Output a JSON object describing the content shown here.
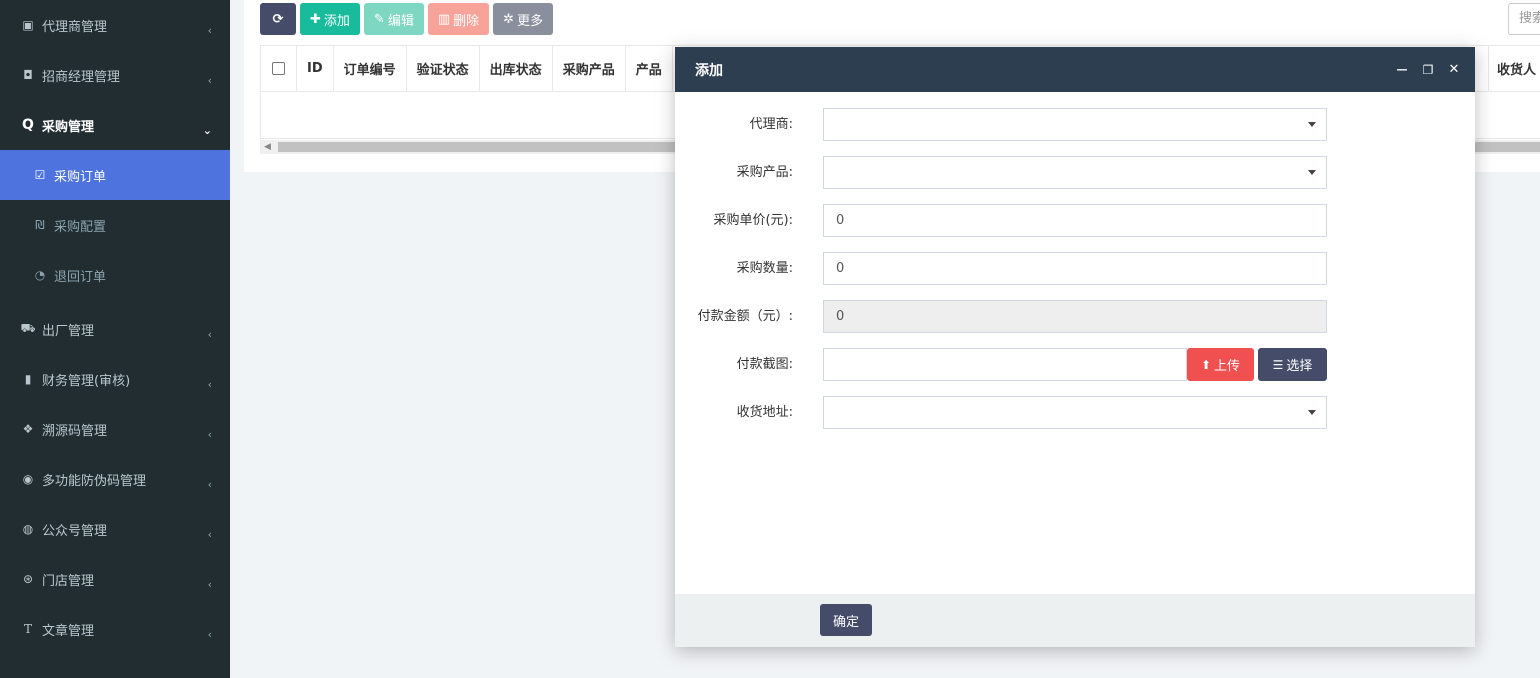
{
  "sidebar": {
    "items": [
      {
        "icon": "id-card-icon",
        "glyph": "▣",
        "label": "代理商管理"
      },
      {
        "icon": "user-badge-icon",
        "glyph": "◘",
        "label": "招商经理管理"
      },
      {
        "icon": "search-icon",
        "glyph": "Q",
        "label": "采购管理"
      },
      {
        "icon": "truck-icon",
        "glyph": "⛟",
        "label": "出厂管理"
      },
      {
        "icon": "book-icon",
        "glyph": "▮",
        "label": "财务管理(审核)"
      },
      {
        "icon": "cubes-icon",
        "glyph": "❖",
        "label": "溯源码管理"
      },
      {
        "icon": "info-circle-icon",
        "glyph": "◉",
        "label": "多功能防伪码管理"
      },
      {
        "icon": "wechat-icon",
        "glyph": "◍",
        "label": "公众号管理"
      },
      {
        "icon": "cog-circle-icon",
        "glyph": "⊛",
        "label": "门店管理"
      },
      {
        "icon": "text-icon",
        "glyph": "T",
        "label": "文章管理"
      }
    ],
    "subitems": [
      {
        "icon": "calendar-check-icon",
        "glyph": "☑",
        "label": "采购订单"
      },
      {
        "icon": "sliders-icon",
        "glyph": "₪",
        "label": "采购配置"
      },
      {
        "icon": "undo-icon",
        "glyph": "◔",
        "label": "退回订单"
      }
    ]
  },
  "toolbar": {
    "refresh_glyph": "⟳",
    "add_label": "添加",
    "add_glyph": "✚",
    "edit_label": "编辑",
    "edit_glyph": "✎",
    "delete_label": "删除",
    "delete_glyph": "▥",
    "more_label": "更多",
    "more_glyph": "✲"
  },
  "search": {
    "placeholder": "搜索"
  },
  "table": {
    "columns": [
      "ID",
      "订单编号",
      "验证状态",
      "出库状态",
      "采购产品",
      "产品",
      "收货人"
    ]
  },
  "dialog": {
    "title": "添加",
    "minimize_glyph": "—",
    "maximize_glyph": "❐",
    "close_glyph": "✕",
    "fields": {
      "agent_label": "代理商:",
      "agent_value": "",
      "product_label": "采购产品:",
      "product_value": "",
      "price_label": "采购单价(元):",
      "price_value": "0",
      "qty_label": "采购数量:",
      "qty_value": "0",
      "amount_label": "付款金额（元）:",
      "amount_value": "0",
      "screenshot_label": "付款截图:",
      "screenshot_value": "",
      "upload_label": "上传",
      "upload_glyph": "⬆",
      "choose_label": "选择",
      "choose_glyph": "☰",
      "address_label": "收货地址:",
      "address_value": ""
    },
    "ok_label": "确定"
  },
  "colors": {
    "sidebar_bg": "#222d32",
    "active_item": "#4e73df",
    "header_bg": "#2c3e50",
    "success": "#18bc9c",
    "danger": "#f05050",
    "dark_btn": "#444c69"
  }
}
